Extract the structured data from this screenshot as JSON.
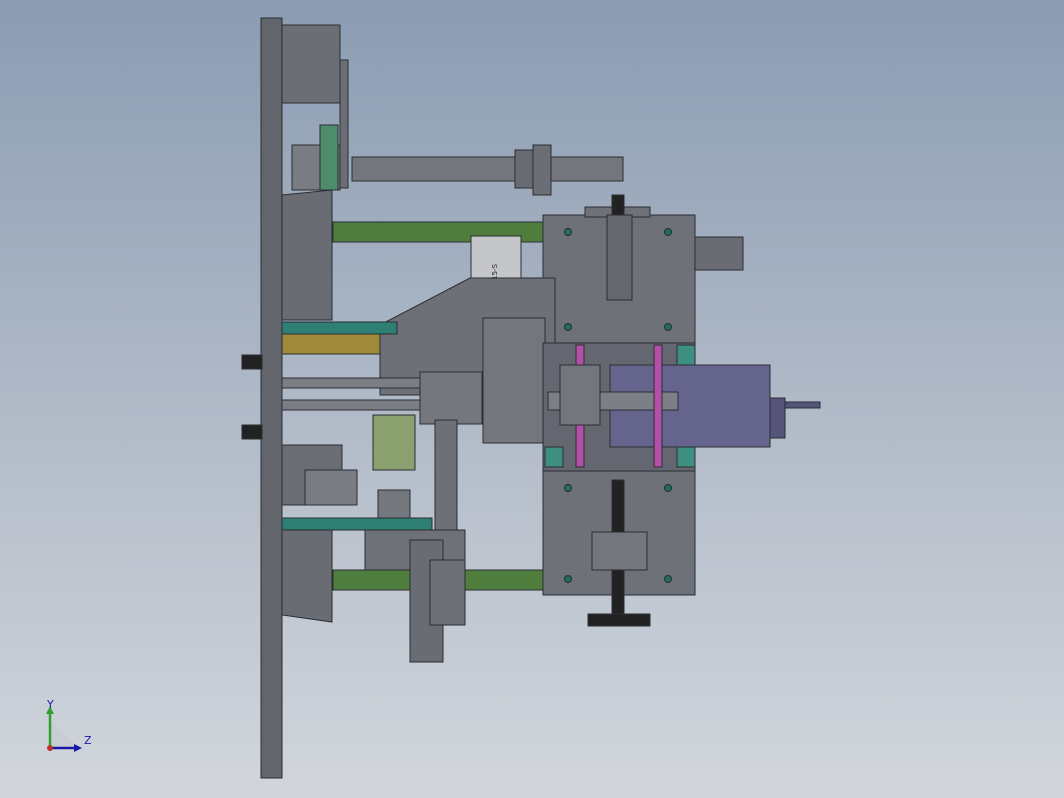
{
  "app": {
    "title": "",
    "view": "Right"
  },
  "model": {
    "part_label": "MZ20-15-S",
    "colors": {
      "plate": "#63656d",
      "plate_dark": "#4a4c54",
      "block": "#707279",
      "green_rail": "#4f7d3e",
      "teal": "#2e7f74",
      "gold": "#9f8a3a",
      "magenta": "#b24fa8",
      "motor": "#64648c",
      "screw": "#222222"
    }
  },
  "triad": {
    "y_label": "Y",
    "z_label": "Z"
  }
}
